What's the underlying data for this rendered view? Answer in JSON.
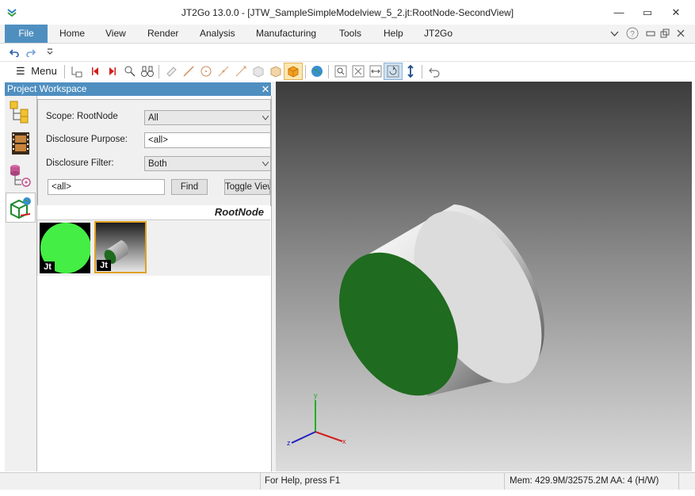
{
  "window": {
    "title": "JT2Go 13.0.0 - [JTW_SampleSimpleModelview_5_2.jt:RootNode-SecondView]",
    "minimize": "—",
    "restore": "▭",
    "close": "✕"
  },
  "menubar": {
    "items": [
      "File",
      "Home",
      "View",
      "Render",
      "Analysis",
      "Manufacturing",
      "Tools",
      "Help",
      "JT2Go"
    ]
  },
  "toolbar": {
    "menu_label": "Menu"
  },
  "workspace": {
    "title": "Project Workspace",
    "close": "✕",
    "filter": {
      "scope_label": "Scope: RootNode",
      "scope_value": "All",
      "purpose_label": "Disclosure Purpose:",
      "purpose_value": "<all>",
      "filter_label": "Disclosure Filter:",
      "filter_value": "Both",
      "search_value": "<all>",
      "find_label": "Find",
      "toggle_label": "Toggle View"
    },
    "node_label": "RootNode",
    "thumbnails": [
      {
        "badge": "Jt"
      },
      {
        "badge": "Jt"
      }
    ]
  },
  "viewport": {
    "axes": {
      "x": "x",
      "y": "y",
      "z": "z"
    }
  },
  "status": {
    "help": "For Help, press F1",
    "memory": "Mem: 429.9M/32575.2M",
    "aa": "AA: 4 (H/W)"
  },
  "colors": {
    "accent": "#4f8fc0",
    "cylinder_face": "#1f6b1f",
    "thumb_green": "#44ee44"
  }
}
